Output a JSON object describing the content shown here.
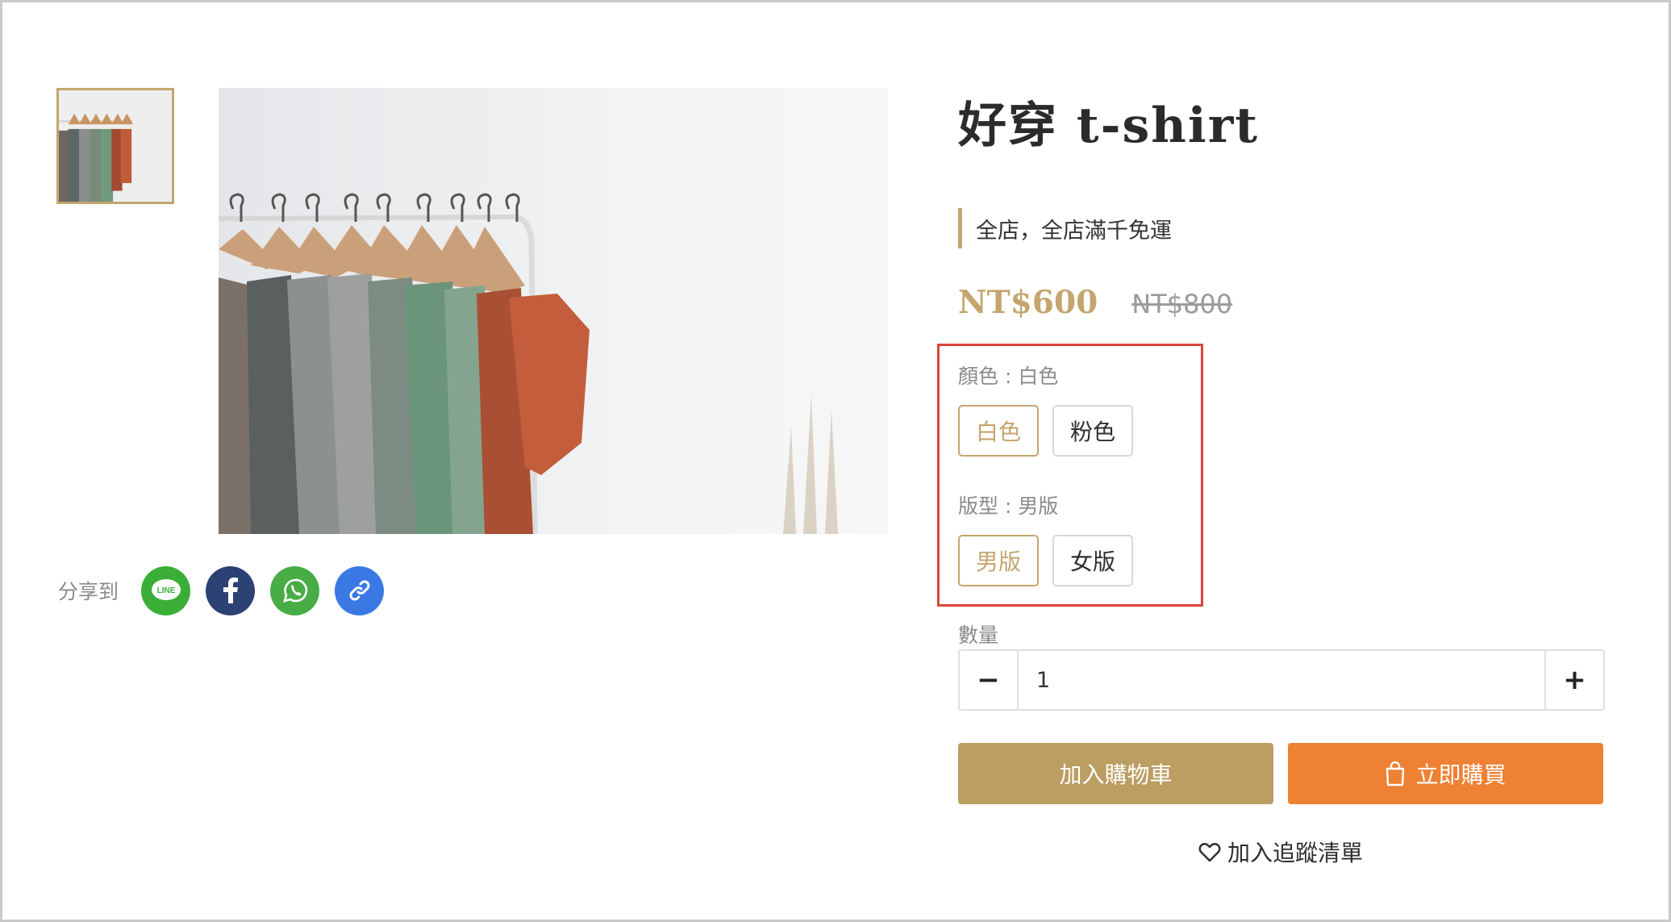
{
  "product": {
    "title": "好穿 t-shirt",
    "promo": "全店，全店滿千免運",
    "price": "NT$600",
    "original_price": "NT$800"
  },
  "share": {
    "label": "分享到",
    "buttons": [
      {
        "icon": "line-icon",
        "text": "LINE",
        "color": "#3aae37"
      },
      {
        "icon": "facebook-icon",
        "color": "#2c4275"
      },
      {
        "icon": "whatsapp-icon",
        "color": "#48ad46"
      },
      {
        "icon": "link-icon",
        "color": "#3a78e4"
      }
    ]
  },
  "variants": {
    "color": {
      "label": "顏色 : 白色",
      "options": [
        "白色",
        "粉色"
      ],
      "selected": "白色"
    },
    "fit": {
      "label": "版型 : 男版",
      "options": [
        "男版",
        "女版"
      ],
      "selected": "男版"
    }
  },
  "quantity": {
    "label": "數量",
    "value": "1",
    "minus": "−",
    "plus": "+"
  },
  "actions": {
    "add_to_cart": "加入購物車",
    "buy_now": "立即購買",
    "wishlist": "加入追蹤清單"
  },
  "colors": {
    "accent": "#c4a56e",
    "cart_button": "#bc9d62",
    "buy_button": "#ee8133",
    "highlight_border": "#d9463b"
  }
}
